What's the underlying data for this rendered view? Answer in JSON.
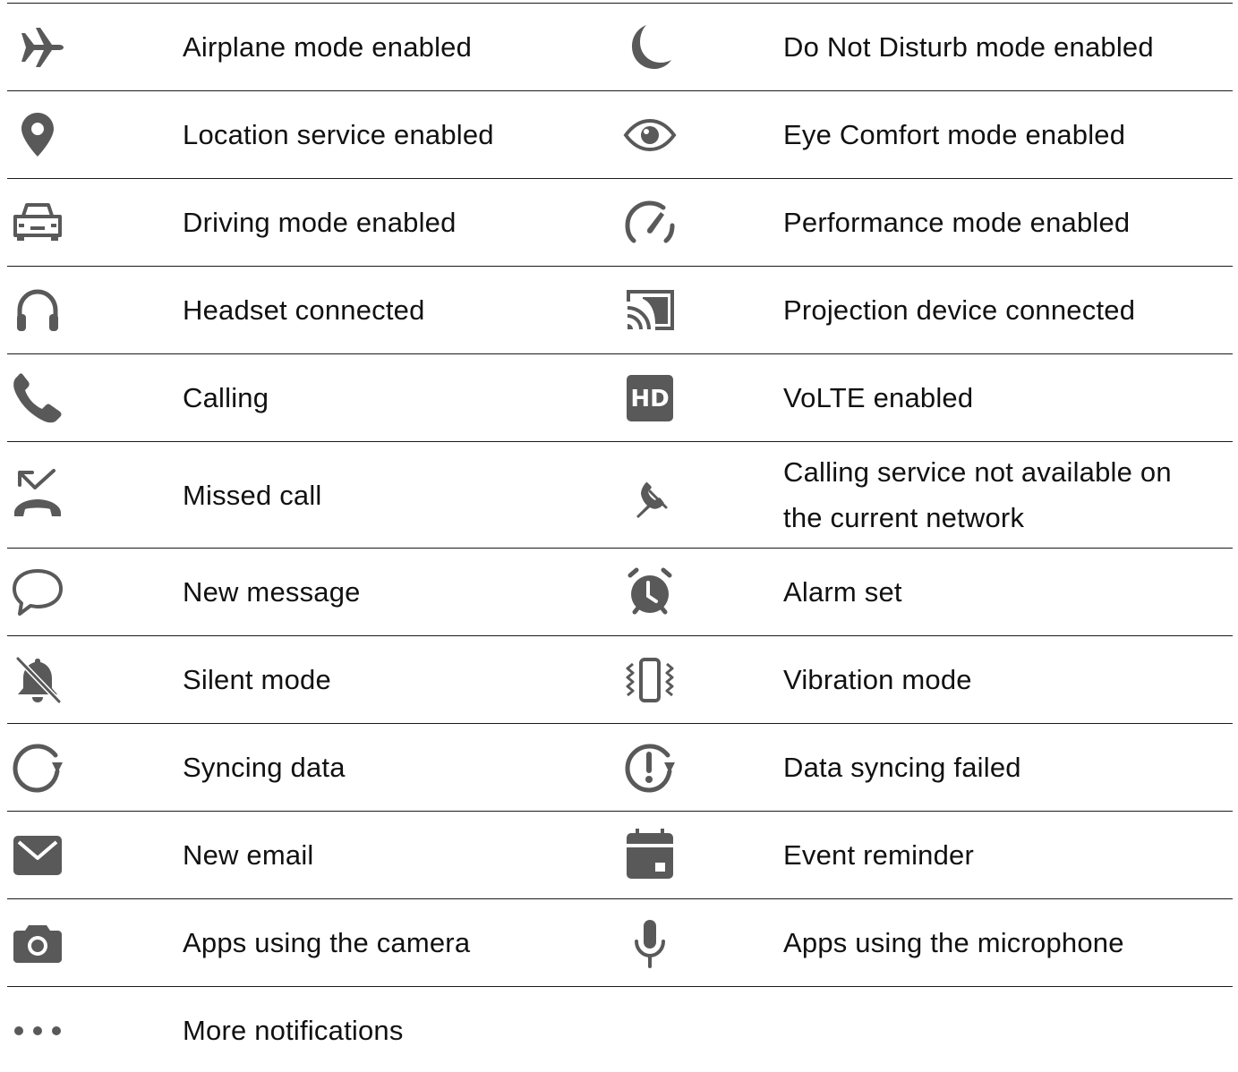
{
  "rows": [
    {
      "left": {
        "icon": "airplane-icon",
        "label": "Airplane mode enabled"
      },
      "right": {
        "icon": "moon-icon",
        "label": "Do Not Disturb mode enabled"
      }
    },
    {
      "left": {
        "icon": "location-pin-icon",
        "label": "Location service enabled"
      },
      "right": {
        "icon": "eye-icon",
        "label": "Eye Comfort mode enabled"
      }
    },
    {
      "left": {
        "icon": "car-icon",
        "label": "Driving mode enabled"
      },
      "right": {
        "icon": "speedometer-icon",
        "label": "Performance mode enabled"
      }
    },
    {
      "left": {
        "icon": "headset-icon",
        "label": "Headset connected"
      },
      "right": {
        "icon": "cast-icon",
        "label": "Projection device connected"
      }
    },
    {
      "left": {
        "icon": "phone-icon",
        "label": "Calling"
      },
      "right": {
        "icon": "hd-icon",
        "label": "VoLTE enabled",
        "icon_text": "HD"
      }
    },
    {
      "left": {
        "icon": "missed-call-icon",
        "label": "Missed call"
      },
      "right": {
        "icon": "phone-disabled-icon",
        "label": "Calling service not available on the current network"
      }
    },
    {
      "left": {
        "icon": "message-bubble-icon",
        "label": "New message"
      },
      "right": {
        "icon": "alarm-clock-icon",
        "label": "Alarm set"
      }
    },
    {
      "left": {
        "icon": "bell-off-icon",
        "label": "Silent mode"
      },
      "right": {
        "icon": "vibration-icon",
        "label": "Vibration mode"
      }
    },
    {
      "left": {
        "icon": "sync-icon",
        "label": "Syncing data"
      },
      "right": {
        "icon": "sync-failed-icon",
        "label": "Data syncing failed"
      }
    },
    {
      "left": {
        "icon": "envelope-icon",
        "label": "New email"
      },
      "right": {
        "icon": "calendar-icon",
        "label": "Event reminder"
      }
    },
    {
      "left": {
        "icon": "camera-icon",
        "label": "Apps using the camera"
      },
      "right": {
        "icon": "microphone-icon",
        "label": "Apps using the microphone"
      }
    },
    {
      "left": {
        "icon": "more-dots-icon",
        "label": "More notifications"
      }
    }
  ],
  "colors": {
    "icon": "#595959",
    "text": "#111111",
    "rule": "#1a1a1a"
  }
}
